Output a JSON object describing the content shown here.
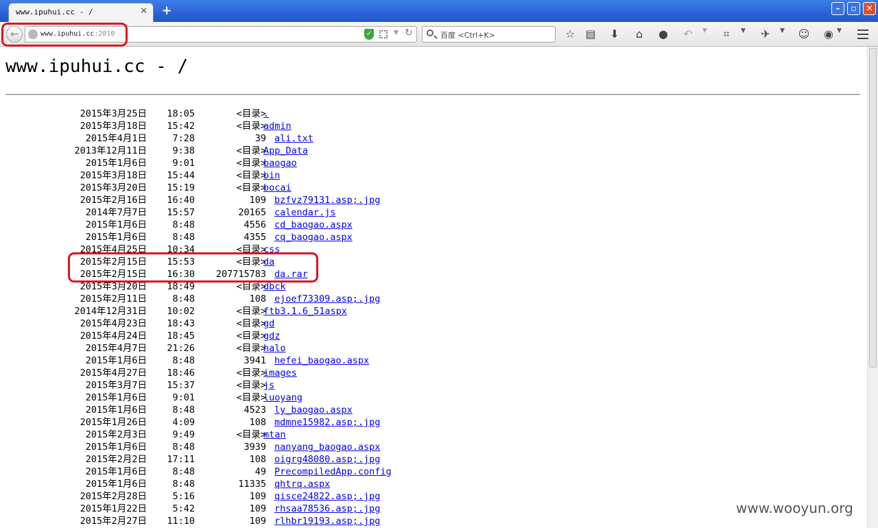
{
  "browser": {
    "tab_title": "www.ipuhui.cc - /",
    "tab_close": "✕",
    "new_tab": "+",
    "url_host": "www.ipuhui.cc",
    "url_port": ":2010",
    "search_placeholder": "百度 <Ctrl+K>"
  },
  "page": {
    "title": "www.ipuhui.cc - /",
    "dir_tag": "<目录>",
    "entries": [
      {
        "date": "2015年3月25日",
        "time": "18:05",
        "size": "<目录>",
        "name": "."
      },
      {
        "date": "2015年3月18日",
        "time": "15:42",
        "size": "<目录>",
        "name": "admin"
      },
      {
        "date": "2015年4月1日",
        "time": "7:28",
        "size": "39",
        "name": "ali.txt"
      },
      {
        "date": "2013年12月11日",
        "time": "9:38",
        "size": "<目录>",
        "name": "App_Data"
      },
      {
        "date": "2015年1月6日",
        "time": "9:01",
        "size": "<目录>",
        "name": "baogao"
      },
      {
        "date": "2015年3月18日",
        "time": "15:44",
        "size": "<目录>",
        "name": "bin"
      },
      {
        "date": "2015年3月20日",
        "time": "15:19",
        "size": "<目录>",
        "name": "bocai"
      },
      {
        "date": "2015年2月16日",
        "time": "16:40",
        "size": "109",
        "name": "bzfvz79131.asp;.jpg"
      },
      {
        "date": "2014年7月7日",
        "time": "15:57",
        "size": "20165",
        "name": "calendar.js"
      },
      {
        "date": "2015年1月6日",
        "time": "8:48",
        "size": "4556",
        "name": "cd_baogao.aspx"
      },
      {
        "date": "2015年1月6日",
        "time": "8:48",
        "size": "4355",
        "name": "cq_baogao.aspx"
      },
      {
        "date": "2015年4月25日",
        "time": "10:34",
        "size": "<目录>",
        "name": "css"
      },
      {
        "date": "2015年2月15日",
        "time": "15:53",
        "size": "<目录>",
        "name": "da"
      },
      {
        "date": "2015年2月15日",
        "time": "16:30",
        "size": "207715783",
        "name": "da.rar"
      },
      {
        "date": "2015年3月20日",
        "time": "18:49",
        "size": "<目录>",
        "name": "dbck"
      },
      {
        "date": "2015年2月11日",
        "time": "8:48",
        "size": "108",
        "name": "ejoef73309.asp;.jpg"
      },
      {
        "date": "2014年12月31日",
        "time": "10:02",
        "size": "<目录>",
        "name": "ftb3.1.6_51aspx"
      },
      {
        "date": "2015年4月23日",
        "time": "18:43",
        "size": "<目录>",
        "name": "gd"
      },
      {
        "date": "2015年4月24日",
        "time": "18:45",
        "size": "<目录>",
        "name": "gdz"
      },
      {
        "date": "2015年4月7日",
        "time": "21:26",
        "size": "<目录>",
        "name": "halo"
      },
      {
        "date": "2015年1月6日",
        "time": "8:48",
        "size": "3941",
        "name": "hefei_baogao.aspx"
      },
      {
        "date": "2015年4月27日",
        "time": "18:46",
        "size": "<目录>",
        "name": "images"
      },
      {
        "date": "2015年3月7日",
        "time": "15:37",
        "size": "<目录>",
        "name": "js"
      },
      {
        "date": "2015年1月6日",
        "time": "9:01",
        "size": "<目录>",
        "name": "luoyang"
      },
      {
        "date": "2015年1月6日",
        "time": "8:48",
        "size": "4523",
        "name": "ly_baogao.aspx"
      },
      {
        "date": "2015年1月26日",
        "time": "4:09",
        "size": "108",
        "name": "mdmne15982.asp;.jpg"
      },
      {
        "date": "2015年2月3日",
        "time": "9:49",
        "size": "<目录>",
        "name": "mtan"
      },
      {
        "date": "2015年1月6日",
        "time": "8:48",
        "size": "3939",
        "name": "nanyang_baogao.aspx"
      },
      {
        "date": "2015年2月2日",
        "time": "17:11",
        "size": "108",
        "name": "oigrg48080.asp;.jpg"
      },
      {
        "date": "2015年1月6日",
        "time": "8:48",
        "size": "49",
        "name": "PrecompiledApp.config"
      },
      {
        "date": "2015年1月6日",
        "time": "8:48",
        "size": "11335",
        "name": "qhtrq.aspx"
      },
      {
        "date": "2015年2月28日",
        "time": "5:16",
        "size": "109",
        "name": "qisce24822.asp;.jpg"
      },
      {
        "date": "2015年1月22日",
        "time": "5:42",
        "size": "109",
        "name": "rhsaa78536.asp;.jpg"
      },
      {
        "date": "2015年2月27日",
        "time": "11:10",
        "size": "109",
        "name": "rlhbr19193.asp;.jpg"
      }
    ]
  },
  "watermark": "www.wooyun.org"
}
